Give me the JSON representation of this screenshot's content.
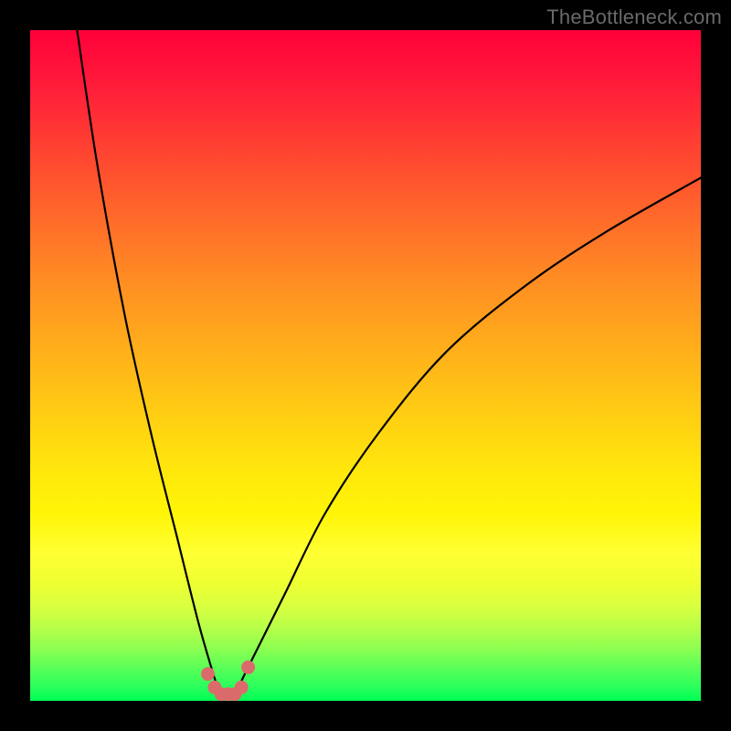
{
  "watermark": "TheBottleneck.com",
  "colors": {
    "gradient_top": "#ff003a",
    "gradient_mid": "#ffd012",
    "gradient_bottom": "#00ff55",
    "curve": "#000000",
    "marker": "#db6b6b",
    "frame": "#000000"
  },
  "chart_data": {
    "type": "line",
    "title": "",
    "xlabel": "",
    "ylabel": "",
    "xlim": [
      0,
      100
    ],
    "ylim": [
      0,
      100
    ],
    "grid": false,
    "legend": false,
    "note": "Curve is a V-shaped bottleneck profile. y-axis runs 0 (bottom/green) to 100 (top/red). Minimum sits near x≈29 with y≈1. Left branch rises steeply to y≈100 at x≈7; right branch rises more gradually reaching y≈78 at x=100.",
    "series": [
      {
        "name": "bottleneck-curve",
        "x": [
          7,
          10,
          14,
          18,
          22,
          25,
          27,
          28,
          29,
          30,
          31,
          32,
          34,
          38,
          44,
          52,
          62,
          74,
          86,
          100
        ],
        "y": [
          100,
          80,
          58,
          40,
          24,
          12,
          5,
          2,
          1,
          1,
          2,
          4,
          8,
          16,
          28,
          40,
          52,
          62,
          70,
          78
        ]
      }
    ],
    "markers": {
      "name": "highlighted-points",
      "x": [
        26.5,
        27.5,
        28.5,
        29.5,
        30.5,
        31.5,
        32.5
      ],
      "y": [
        4,
        2,
        1,
        1,
        1,
        2,
        5
      ]
    }
  }
}
